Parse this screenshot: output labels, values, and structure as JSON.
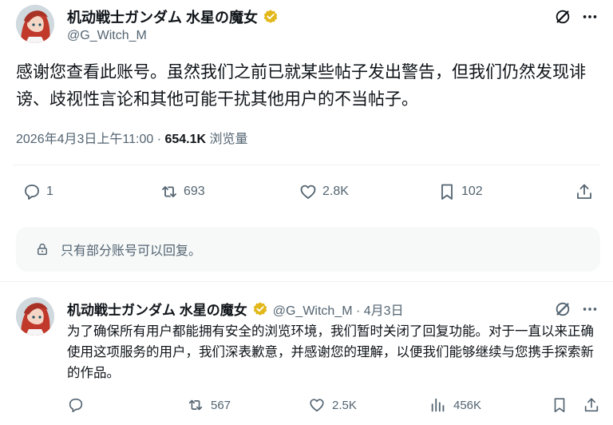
{
  "main_post": {
    "author_name": "机动戦士ガンダム 水星の魔女",
    "handle": "@G_Witch_M",
    "text": "感谢您查看此账号。虽然我们之前已就某些帖子发出警告，但我们仍然发现诽谤、歧视性言论和其他可能干扰其他用户的不当帖子。",
    "timestamp": "2026年4月3日上午11:00",
    "separator": " · ",
    "views_count": "654.1K",
    "views_label": "浏览量",
    "stats": {
      "replies": "1",
      "reposts": "693",
      "likes": "2.8K",
      "bookmarks": "102"
    },
    "reply_restriction": "只有部分账号可以回复。"
  },
  "reply_post": {
    "author_name": "机动戦士ガンダム 水星の魔女",
    "handle_date": "@G_Witch_M · 4月3日",
    "text": "为了确保所有用户都能拥有安全的浏览环境，我们暂时关闭了回复功能。对于一直以来正确使用这项服务的用户，我们深表歉意，并感谢您的理解，以便我们能够继续与您携手探索新的作品。",
    "stats": {
      "reposts": "567",
      "likes": "2.5K",
      "views": "456K"
    }
  },
  "colors": {
    "text_primary": "#0f1419",
    "text_secondary": "#536471",
    "verified_gold": "#e2b719",
    "divider": "#eff3f4"
  },
  "icons": [
    "grok-icon",
    "more-icon",
    "reply-icon",
    "repost-icon",
    "like-icon",
    "bookmark-icon",
    "share-icon",
    "lock-icon",
    "views-icon",
    "verified-icon"
  ]
}
